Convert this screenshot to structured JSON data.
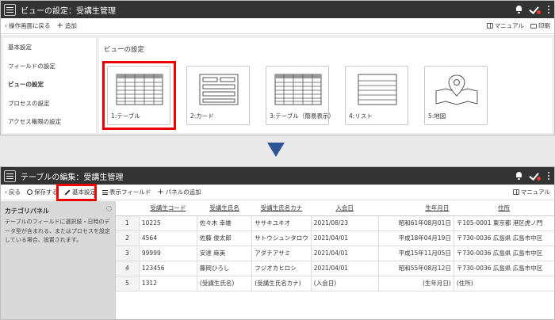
{
  "top_panel": {
    "title": "ビューの設定：受講生管理",
    "back_label": "操作画面に戻る",
    "add_label": "追加",
    "manual_label": "マニュアル",
    "print_label": "印刷",
    "nav": [
      "基本設定",
      "フィールドの設定",
      "ビューの設定",
      "プロセスの設定",
      "アクセス権限の設定"
    ],
    "heading": "ビューの設定",
    "views": [
      {
        "label": "1:テーブル",
        "icon": "table-view-icon"
      },
      {
        "label": "2:カード",
        "icon": "card-view-icon"
      },
      {
        "label": "3:テーブル（簡易表示）",
        "icon": "simple-table-view-icon"
      },
      {
        "label": "4:リスト",
        "icon": "list-view-icon"
      },
      {
        "label": "5:地図",
        "icon": "map-view-icon"
      }
    ]
  },
  "bottom_panel": {
    "title": "テーブルの編集：受講生管理",
    "back_label": "戻る",
    "save_label": "保存する",
    "basic_label": "基本設定",
    "display_field_label": "表示フィールド",
    "add_panel_label": "パネルの追加",
    "manual_label": "マニュアル",
    "category_title": "カテゴリパネル",
    "category_desc": "テーブルのフィールドに選択肢・日時のデータ型が含まれる、またはプロセスを設定している場合、設置されます。",
    "columns": [
      "受講生コード",
      "受講生氏名",
      "受講生氏名カナ",
      "入会日",
      "生年月日",
      "住所"
    ],
    "rows": [
      {
        "n": "1",
        "code": "10225",
        "name": "佐々木 幸雄",
        "kana": "ササキユキオ",
        "join": "2021/08/23",
        "birth": "昭和61年08月01日",
        "addr": "〒105-0001 東京都 港区虎ノ門"
      },
      {
        "n": "2",
        "code": "4564",
        "name": "佐藤 俊太郎",
        "kana": "サトウシュンタロウ",
        "join": "2021/04/01",
        "birth": "平成18年04月19日",
        "addr": "〒730-0036 広島県 広島市中区"
      },
      {
        "n": "3",
        "code": "99999",
        "name": "安達 麻美",
        "kana": "アダチアサミ",
        "join": "2021/04/01",
        "birth": "平成15年11月05日",
        "addr": "〒730-0036 広島県 広島市中区"
      },
      {
        "n": "4",
        "code": "123456",
        "name": "藤岡ひろし",
        "kana": "フジオカヒロシ",
        "join": "2021/04/01",
        "birth": "昭和55年08月12日",
        "addr": "〒730-0036 広島県 広島市中区"
      },
      {
        "n": "5",
        "code": "1312",
        "name": "(受講生氏名)",
        "kana": "(受講生氏名カナ)",
        "join": "(入会日)",
        "birth": "(生年月日)",
        "addr": "(住所)"
      }
    ]
  },
  "colors": {
    "topbar": "#333333",
    "highlight": "#e00000",
    "arrow": "#2f5597"
  }
}
